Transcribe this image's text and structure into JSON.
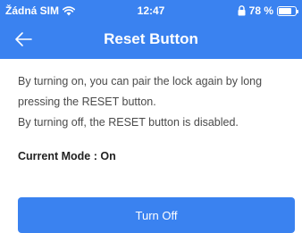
{
  "status_bar": {
    "carrier": "Žádná SIM",
    "time": "12:47",
    "battery": "78 %",
    "battery_level": 0.78
  },
  "nav": {
    "back_icon": "arrow-left-icon",
    "title": "Reset Button"
  },
  "content": {
    "line1": "By turning on, you can pair the lock again by long",
    "line2": "pressing the RESET button.",
    "line3": "By turning off, the RESET button is disabled."
  },
  "mode": {
    "text": "Current Mode : On"
  },
  "action_button": {
    "label": "Turn Off"
  },
  "colors": {
    "accent": "#3a82f0",
    "text": "#4a4a4a"
  }
}
